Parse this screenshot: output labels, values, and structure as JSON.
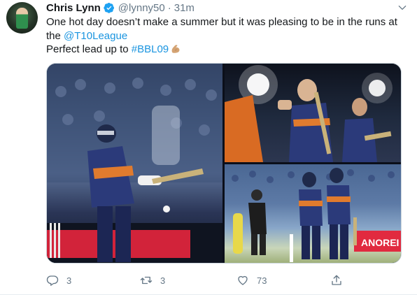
{
  "tweet": {
    "author_name": "Chris Lynn",
    "handle": "@lynny50",
    "separator": "·",
    "time": "31m",
    "text_line1": "One hot day doesn’t make a summer but it was pleasing to be in the runs at",
    "text_line2_prefix": "the ",
    "mention": "@T10League",
    "text_line3_prefix": "Perfect lead up to ",
    "hashtag": "#BBL09",
    "emoji": "flexed-biceps",
    "photo_banner_text": "ANOREI"
  },
  "actions": {
    "reply_count": "3",
    "retweet_count": "3",
    "like_count": "73"
  },
  "colors": {
    "link": "#1b95e0",
    "muted": "#657786",
    "verified": "#1da1f2",
    "jersey": "#2b3a7a",
    "jersey_accent": "#e07b2e"
  }
}
